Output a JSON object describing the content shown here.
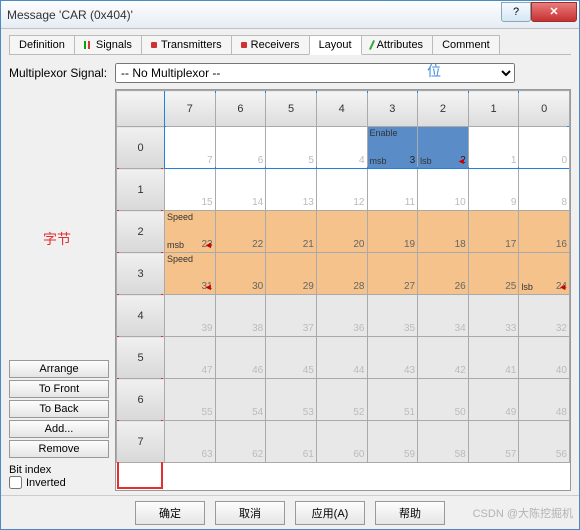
{
  "window": {
    "title": "Message 'CAR (0x404)'"
  },
  "tabs": [
    "Definition",
    "Signals",
    "Transmitters",
    "Receivers",
    "Layout",
    "Attributes",
    "Comment"
  ],
  "activeTab": 4,
  "mux": {
    "label": "Multiplexor Signal:",
    "value": "-- No Multiplexor --"
  },
  "annot": {
    "bitLabel": "位",
    "byteLabel": "字节"
  },
  "buttons": {
    "arrange": "Arrange",
    "front": "To Front",
    "back": "To Back",
    "add": "Add...",
    "remove": "Remove"
  },
  "bitIndex": {
    "title": "Bit index",
    "inverted": "Inverted"
  },
  "grid": {
    "cols": [
      "7",
      "6",
      "5",
      "4",
      "3",
      "2",
      "1",
      "0"
    ],
    "rows": [
      {
        "hdr": "0",
        "cells": [
          {
            "n": "7"
          },
          {
            "n": "6"
          },
          {
            "n": "5"
          },
          {
            "n": "4"
          },
          {
            "n": "3",
            "cls": "blue",
            "top": "Enable",
            "msb": "msb"
          },
          {
            "n": "2",
            "cls": "blue",
            "lsb": "lsb",
            "rm": "◄"
          },
          {
            "n": "1"
          },
          {
            "n": "0"
          }
        ]
      },
      {
        "hdr": "1",
        "cells": [
          {
            "n": "15"
          },
          {
            "n": "14"
          },
          {
            "n": "13"
          },
          {
            "n": "12"
          },
          {
            "n": "11"
          },
          {
            "n": "10"
          },
          {
            "n": "9"
          },
          {
            "n": "8"
          }
        ]
      },
      {
        "hdr": "2",
        "cells": [
          {
            "n": "23",
            "cls": "orange",
            "top": "Speed",
            "msb": "msb",
            "rm": "◄"
          },
          {
            "n": "22",
            "cls": "orange"
          },
          {
            "n": "21",
            "cls": "orange"
          },
          {
            "n": "20",
            "cls": "orange"
          },
          {
            "n": "19",
            "cls": "orange"
          },
          {
            "n": "18",
            "cls": "orange"
          },
          {
            "n": "17",
            "cls": "orange"
          },
          {
            "n": "16",
            "cls": "orange"
          }
        ]
      },
      {
        "hdr": "3",
        "cells": [
          {
            "n": "31",
            "cls": "orange",
            "top": "Speed",
            "rm": "◄"
          },
          {
            "n": "30",
            "cls": "orange"
          },
          {
            "n": "29",
            "cls": "orange"
          },
          {
            "n": "28",
            "cls": "orange"
          },
          {
            "n": "27",
            "cls": "orange"
          },
          {
            "n": "26",
            "cls": "orange"
          },
          {
            "n": "25",
            "cls": "orange"
          },
          {
            "n": "24",
            "cls": "orange",
            "lsb": "lsb",
            "rm": "◄"
          }
        ]
      },
      {
        "hdr": "4",
        "cells": [
          {
            "n": "39",
            "cls": "gray"
          },
          {
            "n": "38",
            "cls": "gray"
          },
          {
            "n": "37",
            "cls": "gray"
          },
          {
            "n": "36",
            "cls": "gray"
          },
          {
            "n": "35",
            "cls": "gray"
          },
          {
            "n": "34",
            "cls": "gray"
          },
          {
            "n": "33",
            "cls": "gray"
          },
          {
            "n": "32",
            "cls": "gray"
          }
        ]
      },
      {
        "hdr": "5",
        "cells": [
          {
            "n": "47",
            "cls": "gray"
          },
          {
            "n": "46",
            "cls": "gray"
          },
          {
            "n": "45",
            "cls": "gray"
          },
          {
            "n": "44",
            "cls": "gray"
          },
          {
            "n": "43",
            "cls": "gray"
          },
          {
            "n": "42",
            "cls": "gray"
          },
          {
            "n": "41",
            "cls": "gray"
          },
          {
            "n": "40",
            "cls": "gray"
          }
        ]
      },
      {
        "hdr": "6",
        "cells": [
          {
            "n": "55",
            "cls": "gray"
          },
          {
            "n": "54",
            "cls": "gray"
          },
          {
            "n": "53",
            "cls": "gray"
          },
          {
            "n": "52",
            "cls": "gray"
          },
          {
            "n": "51",
            "cls": "gray"
          },
          {
            "n": "50",
            "cls": "gray"
          },
          {
            "n": "49",
            "cls": "gray"
          },
          {
            "n": "48",
            "cls": "gray"
          }
        ]
      },
      {
        "hdr": "7",
        "cells": [
          {
            "n": "63",
            "cls": "gray"
          },
          {
            "n": "62",
            "cls": "gray"
          },
          {
            "n": "61",
            "cls": "gray"
          },
          {
            "n": "60",
            "cls": "gray"
          },
          {
            "n": "59",
            "cls": "gray"
          },
          {
            "n": "58",
            "cls": "gray"
          },
          {
            "n": "57",
            "cls": "gray"
          },
          {
            "n": "56",
            "cls": "gray"
          }
        ]
      }
    ]
  },
  "footer": {
    "ok": "确定",
    "cancel": "取消",
    "apply": "应用(A)",
    "help": "帮助"
  },
  "watermark": "CSDN @大陈挖掘机"
}
